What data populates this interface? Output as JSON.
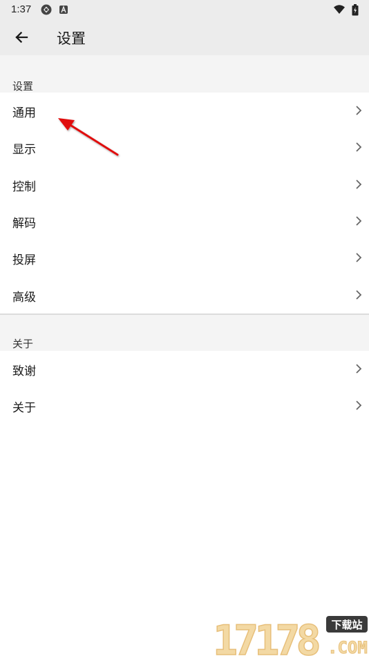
{
  "status_bar": {
    "time": "1:37",
    "icons": [
      "sync-icon",
      "keyboard-a-icon",
      "wifi-icon",
      "battery-icon"
    ]
  },
  "app_bar": {
    "title": "设置"
  },
  "sections": [
    {
      "header": "设置",
      "items": [
        {
          "label": "通用"
        },
        {
          "label": "显示"
        },
        {
          "label": "控制"
        },
        {
          "label": "解码"
        },
        {
          "label": "投屏"
        },
        {
          "label": "高级"
        }
      ]
    },
    {
      "header": "关于",
      "items": [
        {
          "label": "致谢"
        },
        {
          "label": "关于"
        }
      ]
    }
  ],
  "watermark": {
    "logo": "17178",
    "tag": "下载站",
    "suffix": ".COM"
  },
  "colors": {
    "app_bar_bg": "#ececec",
    "section_bg": "#f4f4f4",
    "annotation_arrow": "#e01010"
  }
}
